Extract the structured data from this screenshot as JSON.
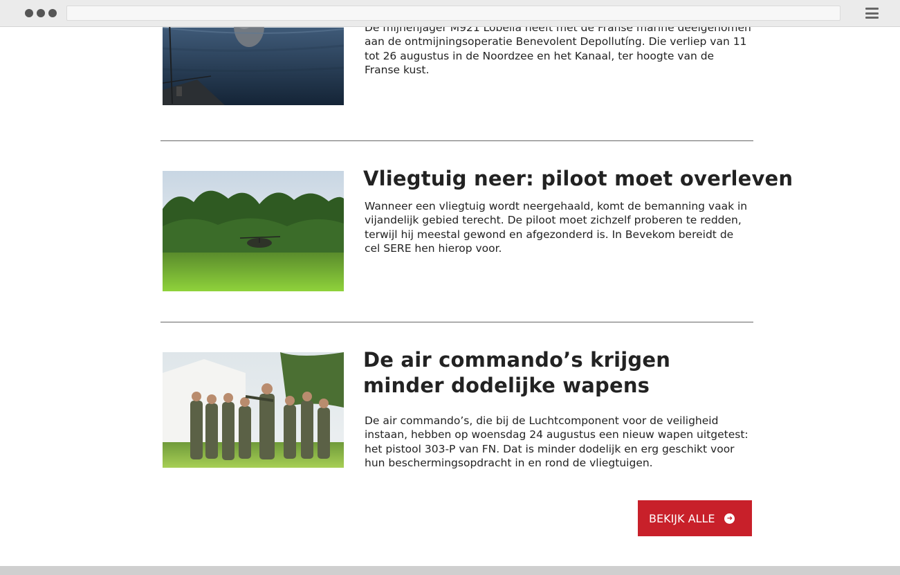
{
  "articles": [
    {
      "title": "",
      "body": "De mijnenjager M921 Lobelia heeft met de Franse marine deelgenomen aan de ontmijningsoperatie Benevolent Depollutíng. Die verliep van 11 tot 26 augustus in de Noordzee en het Kanaal, ter hoogte van de Franse kust."
    },
    {
      "title": "Vliegtuig neer: piloot moet overleven",
      "body": "Wanneer een vliegtuig wordt neergehaald, komt de bemanning vaak in vijandelijk gebied terecht. De piloot moet zichzelf proberen te redden, terwijl hij meestal gewond en afgezonderd is. In Bevekom bereidt de cel SERE hen hierop voor."
    },
    {
      "title": "De air commando’s krijgen minder dodelijke wapens",
      "body": "De air commando’s, die bij de Luchtcomponent voor de veiligheid instaan, hebben op woensdag 24 augustus een nieuw wapen uitgetest: het pistool 303-P van FN. Dat is minder dodelijk en erg geschikt voor hun beschermingsopdracht in en rond de vliegtuigen."
    }
  ],
  "cta": {
    "label": "BEKIJK ALLE",
    "icon": "arrow-circle-right-icon"
  },
  "colors": {
    "accent": "#c8202a"
  }
}
